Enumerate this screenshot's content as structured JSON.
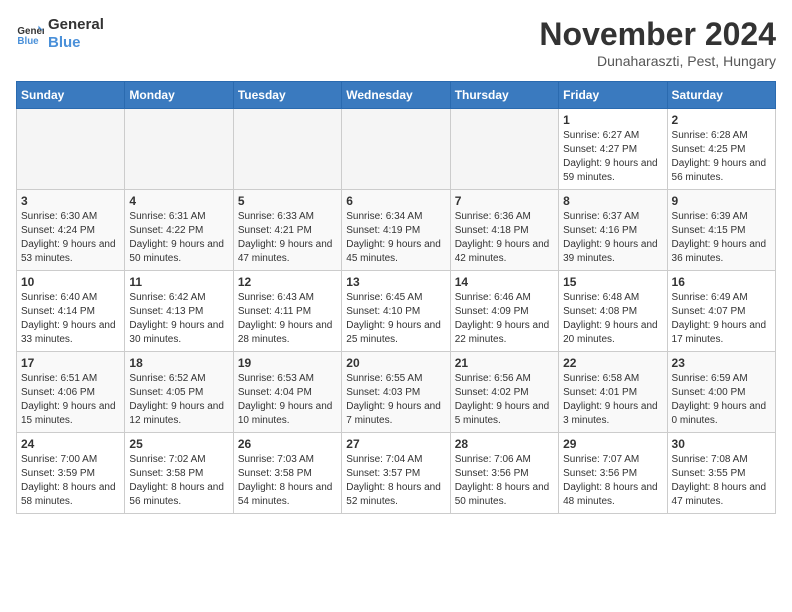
{
  "header": {
    "logo_text_general": "General",
    "logo_text_blue": "Blue",
    "month": "November 2024",
    "location": "Dunaharaszti, Pest, Hungary"
  },
  "weekdays": [
    "Sunday",
    "Monday",
    "Tuesday",
    "Wednesday",
    "Thursday",
    "Friday",
    "Saturday"
  ],
  "weeks": [
    [
      {
        "day": "",
        "info": ""
      },
      {
        "day": "",
        "info": ""
      },
      {
        "day": "",
        "info": ""
      },
      {
        "day": "",
        "info": ""
      },
      {
        "day": "",
        "info": ""
      },
      {
        "day": "1",
        "info": "Sunrise: 6:27 AM\nSunset: 4:27 PM\nDaylight: 9 hours and 59 minutes."
      },
      {
        "day": "2",
        "info": "Sunrise: 6:28 AM\nSunset: 4:25 PM\nDaylight: 9 hours and 56 minutes."
      }
    ],
    [
      {
        "day": "3",
        "info": "Sunrise: 6:30 AM\nSunset: 4:24 PM\nDaylight: 9 hours and 53 minutes."
      },
      {
        "day": "4",
        "info": "Sunrise: 6:31 AM\nSunset: 4:22 PM\nDaylight: 9 hours and 50 minutes."
      },
      {
        "day": "5",
        "info": "Sunrise: 6:33 AM\nSunset: 4:21 PM\nDaylight: 9 hours and 47 minutes."
      },
      {
        "day": "6",
        "info": "Sunrise: 6:34 AM\nSunset: 4:19 PM\nDaylight: 9 hours and 45 minutes."
      },
      {
        "day": "7",
        "info": "Sunrise: 6:36 AM\nSunset: 4:18 PM\nDaylight: 9 hours and 42 minutes."
      },
      {
        "day": "8",
        "info": "Sunrise: 6:37 AM\nSunset: 4:16 PM\nDaylight: 9 hours and 39 minutes."
      },
      {
        "day": "9",
        "info": "Sunrise: 6:39 AM\nSunset: 4:15 PM\nDaylight: 9 hours and 36 minutes."
      }
    ],
    [
      {
        "day": "10",
        "info": "Sunrise: 6:40 AM\nSunset: 4:14 PM\nDaylight: 9 hours and 33 minutes."
      },
      {
        "day": "11",
        "info": "Sunrise: 6:42 AM\nSunset: 4:13 PM\nDaylight: 9 hours and 30 minutes."
      },
      {
        "day": "12",
        "info": "Sunrise: 6:43 AM\nSunset: 4:11 PM\nDaylight: 9 hours and 28 minutes."
      },
      {
        "day": "13",
        "info": "Sunrise: 6:45 AM\nSunset: 4:10 PM\nDaylight: 9 hours and 25 minutes."
      },
      {
        "day": "14",
        "info": "Sunrise: 6:46 AM\nSunset: 4:09 PM\nDaylight: 9 hours and 22 minutes."
      },
      {
        "day": "15",
        "info": "Sunrise: 6:48 AM\nSunset: 4:08 PM\nDaylight: 9 hours and 20 minutes."
      },
      {
        "day": "16",
        "info": "Sunrise: 6:49 AM\nSunset: 4:07 PM\nDaylight: 9 hours and 17 minutes."
      }
    ],
    [
      {
        "day": "17",
        "info": "Sunrise: 6:51 AM\nSunset: 4:06 PM\nDaylight: 9 hours and 15 minutes."
      },
      {
        "day": "18",
        "info": "Sunrise: 6:52 AM\nSunset: 4:05 PM\nDaylight: 9 hours and 12 minutes."
      },
      {
        "day": "19",
        "info": "Sunrise: 6:53 AM\nSunset: 4:04 PM\nDaylight: 9 hours and 10 minutes."
      },
      {
        "day": "20",
        "info": "Sunrise: 6:55 AM\nSunset: 4:03 PM\nDaylight: 9 hours and 7 minutes."
      },
      {
        "day": "21",
        "info": "Sunrise: 6:56 AM\nSunset: 4:02 PM\nDaylight: 9 hours and 5 minutes."
      },
      {
        "day": "22",
        "info": "Sunrise: 6:58 AM\nSunset: 4:01 PM\nDaylight: 9 hours and 3 minutes."
      },
      {
        "day": "23",
        "info": "Sunrise: 6:59 AM\nSunset: 4:00 PM\nDaylight: 9 hours and 0 minutes."
      }
    ],
    [
      {
        "day": "24",
        "info": "Sunrise: 7:00 AM\nSunset: 3:59 PM\nDaylight: 8 hours and 58 minutes."
      },
      {
        "day": "25",
        "info": "Sunrise: 7:02 AM\nSunset: 3:58 PM\nDaylight: 8 hours and 56 minutes."
      },
      {
        "day": "26",
        "info": "Sunrise: 7:03 AM\nSunset: 3:58 PM\nDaylight: 8 hours and 54 minutes."
      },
      {
        "day": "27",
        "info": "Sunrise: 7:04 AM\nSunset: 3:57 PM\nDaylight: 8 hours and 52 minutes."
      },
      {
        "day": "28",
        "info": "Sunrise: 7:06 AM\nSunset: 3:56 PM\nDaylight: 8 hours and 50 minutes."
      },
      {
        "day": "29",
        "info": "Sunrise: 7:07 AM\nSunset: 3:56 PM\nDaylight: 8 hours and 48 minutes."
      },
      {
        "day": "30",
        "info": "Sunrise: 7:08 AM\nSunset: 3:55 PM\nDaylight: 8 hours and 47 minutes."
      }
    ]
  ]
}
